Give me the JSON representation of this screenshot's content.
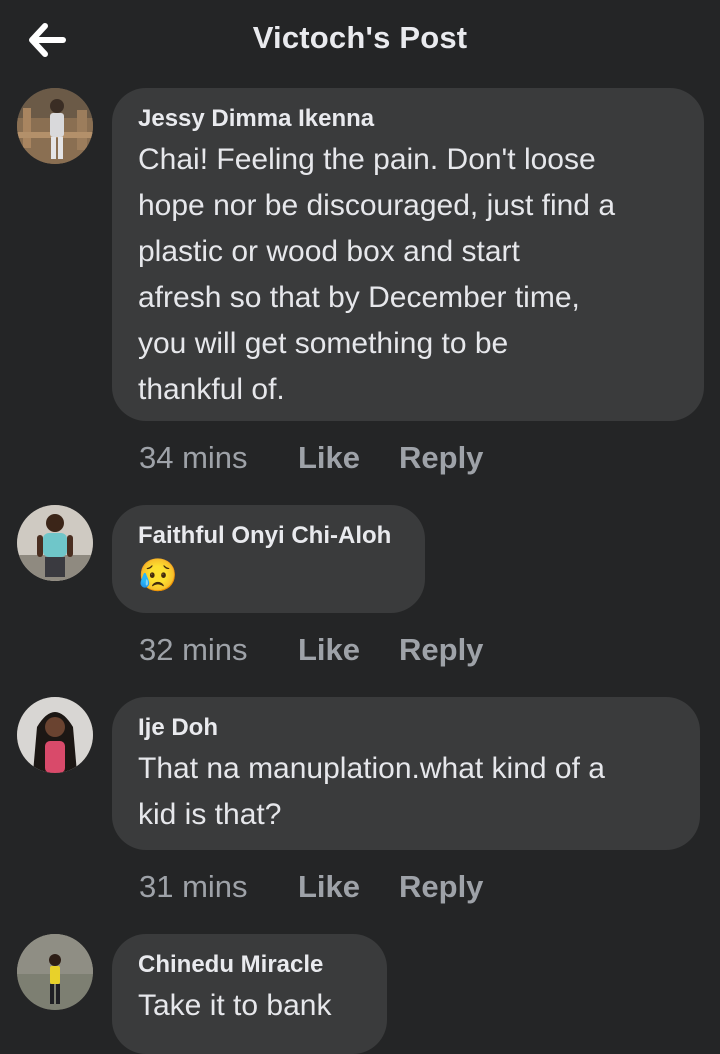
{
  "header": {
    "title": "Victoch's Post",
    "back_icon": "arrow-left-icon"
  },
  "comments": [
    {
      "author": "Jessy Dimma Ikenna",
      "lines": [
        "Chai! Feeling the pain. Don't loose",
        "hope nor be discouraged, just find a",
        "plastic or wood box and start",
        "afresh so that by December time,",
        "you will get something to be",
        "thankful of."
      ],
      "time": "34 mins",
      "like_label": "Like",
      "reply_label": "Reply"
    },
    {
      "author": "Faithful Onyi Chi-Aloh",
      "emoji": "😥",
      "emoji_name": "crying-face-emoji",
      "time": "32 mins",
      "like_label": "Like",
      "reply_label": "Reply"
    },
    {
      "author": "Ije Doh",
      "lines": [
        "That na manuplation.what kind of a",
        "kid is that?"
      ],
      "time": "31 mins",
      "like_label": "Like",
      "reply_label": "Reply"
    },
    {
      "author": "Chinedu Miracle",
      "lines": [
        "Take it to bank"
      ]
    }
  ],
  "colors": {
    "background": "#242526",
    "bubble": "#3a3b3c",
    "text": "#e4e6eb",
    "meta": "#9ea2a8"
  }
}
